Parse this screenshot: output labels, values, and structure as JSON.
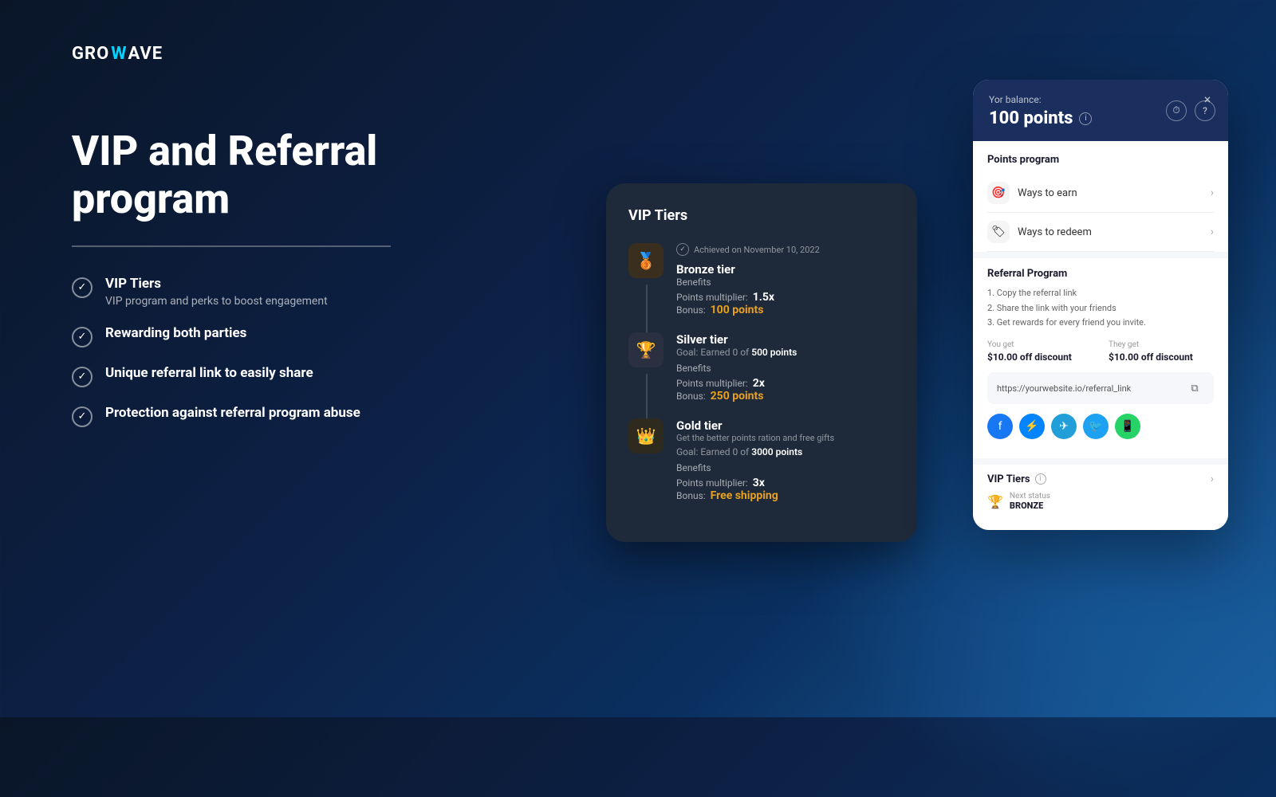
{
  "logo": {
    "part1": "GRO",
    "wave": "W",
    "part2": "AVE"
  },
  "hero": {
    "title": "VIP and Referral program",
    "divider": true,
    "features": [
      {
        "title": "VIP Tiers",
        "subtitle": "VIP program and perks to boost engagement"
      },
      {
        "title": "Rewarding both parties",
        "subtitle": ""
      },
      {
        "title": "Unique referral link to easily share",
        "subtitle": ""
      },
      {
        "title": "Protection against referral program abuse",
        "subtitle": ""
      }
    ]
  },
  "vip_card": {
    "title": "VIP Tiers",
    "tiers": [
      {
        "name": "Bronze tier",
        "achieved": "Achieved on November 10, 2022",
        "icon": "🥉",
        "type": "bronze",
        "benefits_label": "Benefits",
        "multiplier_label": "Points multiplier:",
        "multiplier_value": "1.5x",
        "bonus_label": "Bonus:",
        "bonus_value": "100 points"
      },
      {
        "name": "Silver tier",
        "goal": "Earned 0 of",
        "goal_points": "500 points",
        "icon": "🏆",
        "type": "silver",
        "benefits_label": "Benefits",
        "multiplier_label": "Points multiplier:",
        "multiplier_value": "2x",
        "bonus_label": "Bonus:",
        "bonus_value": "250 points"
      },
      {
        "name": "Gold tier",
        "description": "Get the better points ration and free gifts",
        "goal": "Earned 0 of",
        "goal_points": "3000 points",
        "icon": "👑",
        "type": "gold",
        "benefits_label": "Benefits",
        "multiplier_label": "Points multiplier:",
        "multiplier_value": "3x",
        "bonus_label": "Bonus:",
        "bonus_value": "Free shipping"
      }
    ]
  },
  "widget": {
    "close_label": "×",
    "balance_label": "Yor balance:",
    "balance_amount": "100 points",
    "info_icon": "i",
    "history_icon": "⏱",
    "help_icon": "?",
    "points_program_label": "Points program",
    "ways_to_earn_label": "Ways to earn",
    "ways_to_redeem_label": "Ways to redeem",
    "referral_title": "Referral Program",
    "referral_steps": "1. Copy the referral link\n2. Share the link with your friends\n3. Get rewards for every friend you invite.",
    "you_get_label": "You get",
    "you_get_value": "$10.00 off discount",
    "they_get_label": "They get",
    "they_get_value": "$10.00 off discount",
    "referral_link": "https://yourwebsite.io/referral_link",
    "copy_icon": "⧉",
    "vip_tiers_label": "VIP Tiers",
    "vip_next_label": "Next status",
    "vip_next_value": "BRONZE"
  }
}
